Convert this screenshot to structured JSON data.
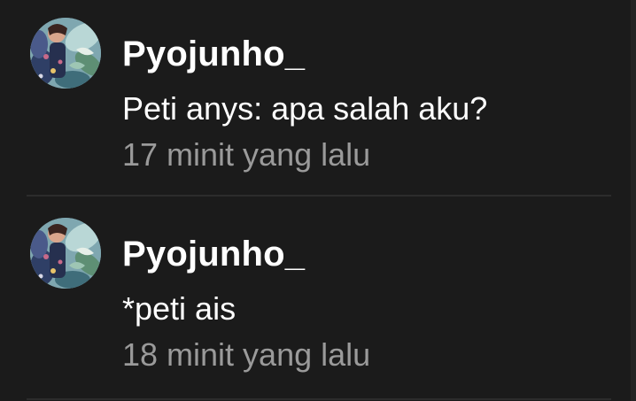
{
  "comments": [
    {
      "username": "Pyojunho_",
      "text": "Peti anys: apa salah aku?",
      "time": "17 minit yang lalu",
      "avatar_icon": "profile-avatar"
    },
    {
      "username": "Pyojunho_",
      "text": "*peti ais",
      "time": "18 minit yang lalu",
      "avatar_icon": "profile-avatar"
    }
  ],
  "colors": {
    "background": "#1b1b1b",
    "username": "#ffffff",
    "text": "#ffffff",
    "time": "#9a9a9a",
    "divider": "#2c2c2c"
  }
}
